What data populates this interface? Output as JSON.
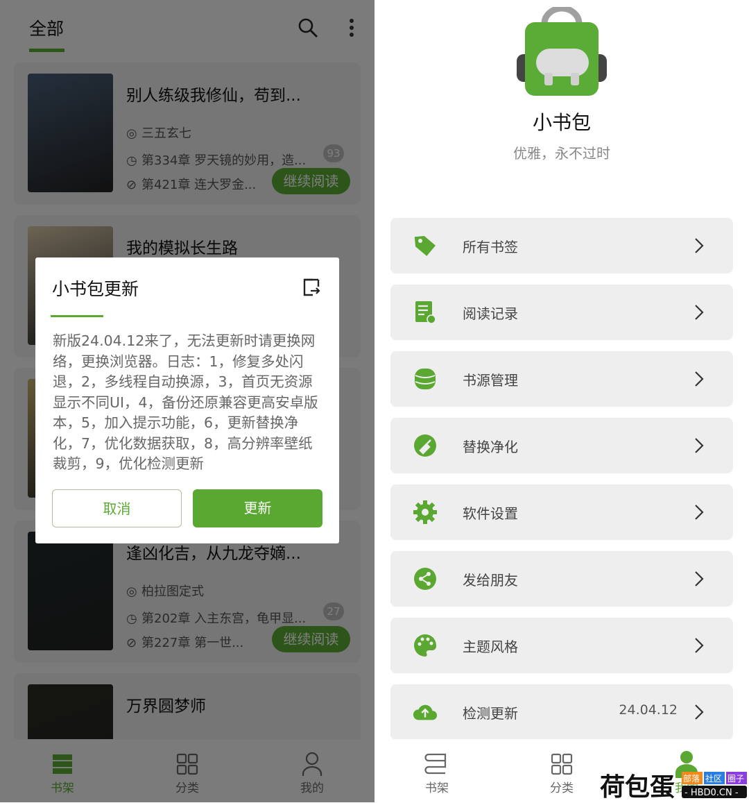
{
  "left": {
    "header": {
      "tab": "全部",
      "search_icon": "search-icon",
      "more_icon": "more-vertical-icon"
    },
    "books": [
      {
        "title": "别人练级我修仙，苟到...",
        "author": "三五玄七",
        "latest": "第334章 罗天镜的妙用，造...",
        "unread": "93",
        "progress": "第421章 连大罗金...",
        "button": "继续阅读",
        "cover_color": "#4a5f78"
      },
      {
        "title": "我的模拟长生路",
        "cover_color": "#d8c8a8"
      },
      {
        "title": "",
        "cover_color": "#c9b070"
      },
      {
        "title": "逢凶化吉，从九龙夺嫡...",
        "author": "柏拉图定式",
        "latest": "第202章 入主东宫，龟甲显...",
        "unread": "27",
        "progress": "第227章 第一世...",
        "button": "继续阅读",
        "cover_color": "#1f2a2c"
      },
      {
        "title": "万界圆梦师",
        "cover_color": "#2a2a22"
      }
    ],
    "nav": [
      {
        "label": "书架",
        "icon": "bookshelf-icon",
        "active": true
      },
      {
        "label": "分类",
        "icon": "grid-icon",
        "active": false
      },
      {
        "label": "我的",
        "icon": "person-icon",
        "active": false
      }
    ],
    "dialog": {
      "title": "小书包更新",
      "open_icon": "open-external-icon",
      "body": "新版24.04.12来了，无法更新时请更换网络，更换浏览器。日志：1，修复多处闪退，2，多线程自动换源，3，首页无资源显示不同UI，4，备份还原兼容更高安卓版本，5，加入提示功能，6，更新替换净化，7，优化数据获取，8，高分辨率壁纸裁剪，9，优化检测更新",
      "cancel": "取消",
      "confirm": "更新"
    }
  },
  "right": {
    "app_name": "小书包",
    "slogan": "优雅，永不过时",
    "menu": [
      {
        "label": "所有书签",
        "icon": "tag-icon"
      },
      {
        "label": "阅读记录",
        "icon": "reading-history-icon"
      },
      {
        "label": "书源管理",
        "icon": "database-icon"
      },
      {
        "label": "替换净化",
        "icon": "broom-icon"
      },
      {
        "label": "软件设置",
        "icon": "gear-icon"
      },
      {
        "label": "发给朋友",
        "icon": "share-icon"
      },
      {
        "label": "主题风格",
        "icon": "palette-icon"
      },
      {
        "label": "检测更新",
        "icon": "cloud-upload-icon",
        "value": "24.04.12"
      }
    ],
    "nav": [
      {
        "label": "书架",
        "icon": "bookshelf-icon",
        "active": false
      },
      {
        "label": "分类",
        "icon": "grid-icon",
        "active": false
      },
      {
        "label": "我的",
        "icon": "person-icon",
        "active": true
      }
    ]
  },
  "watermark": {
    "text": "荷包蛋",
    "tags": [
      "部落",
      "社区",
      "圈子"
    ],
    "domain": "- HBD0.CN -"
  },
  "colors": {
    "accent": "#5aa832",
    "card": "#ececec",
    "text": "#111111"
  }
}
